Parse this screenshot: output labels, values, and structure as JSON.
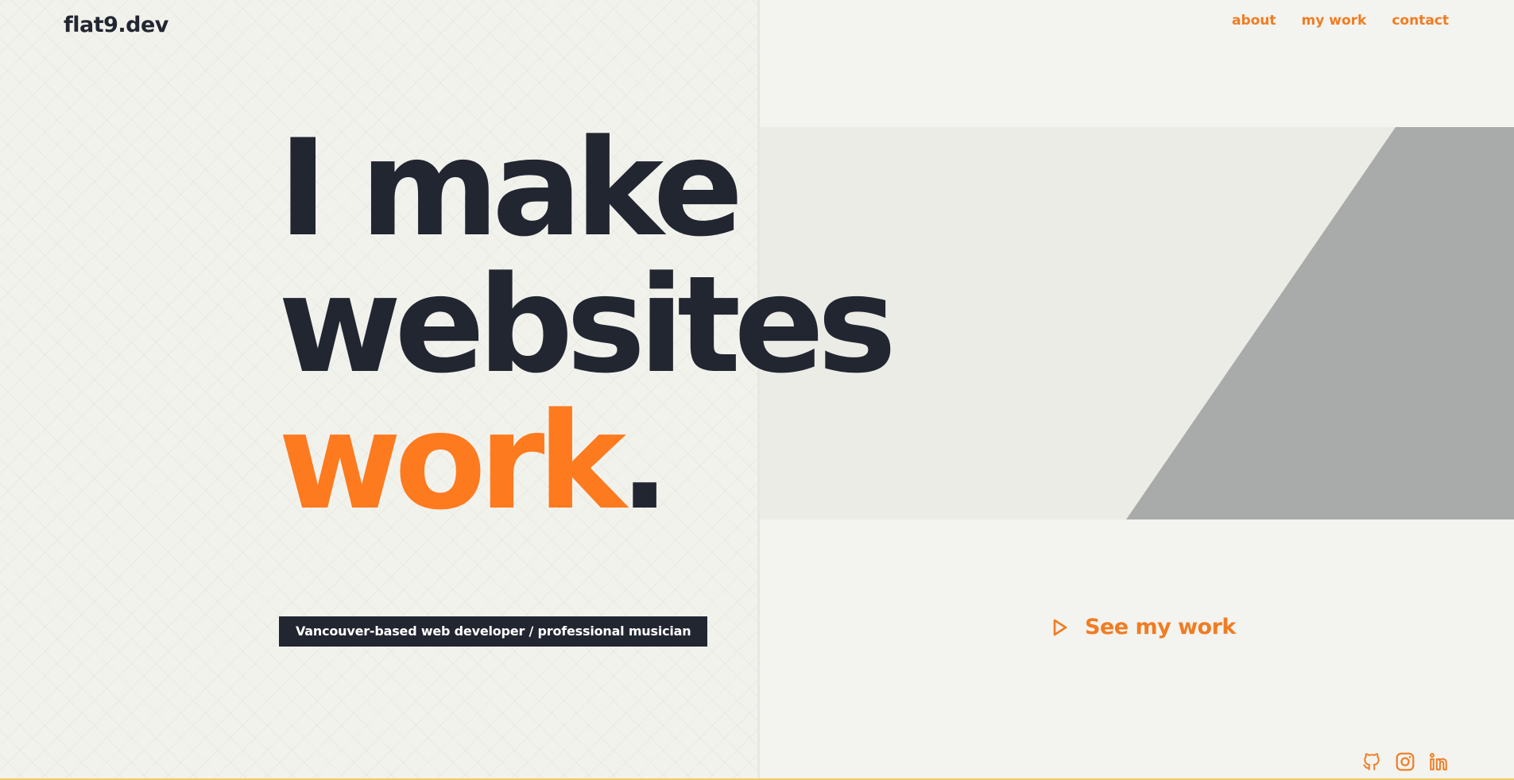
{
  "brand": {
    "logo": "flat9.dev"
  },
  "nav": {
    "items": [
      {
        "label": "about"
      },
      {
        "label": "my work"
      },
      {
        "label": "contact"
      }
    ]
  },
  "hero": {
    "line1": "I make",
    "line2": "websites",
    "line3_accent": "work",
    "line3_period": ".",
    "tagline": "Vancouver-based web developer / professional musician"
  },
  "cta": {
    "label": "See my work",
    "icon": "play-triangle-icon"
  },
  "social": {
    "icons": [
      "github-icon",
      "instagram-icon",
      "linkedin-icon"
    ]
  },
  "colors": {
    "accent": "#f07c22",
    "accent_bright": "#fd7a1f",
    "dark": "#222631",
    "background": "#f3f3ef",
    "diagonal_gray": "#a8abaa"
  }
}
